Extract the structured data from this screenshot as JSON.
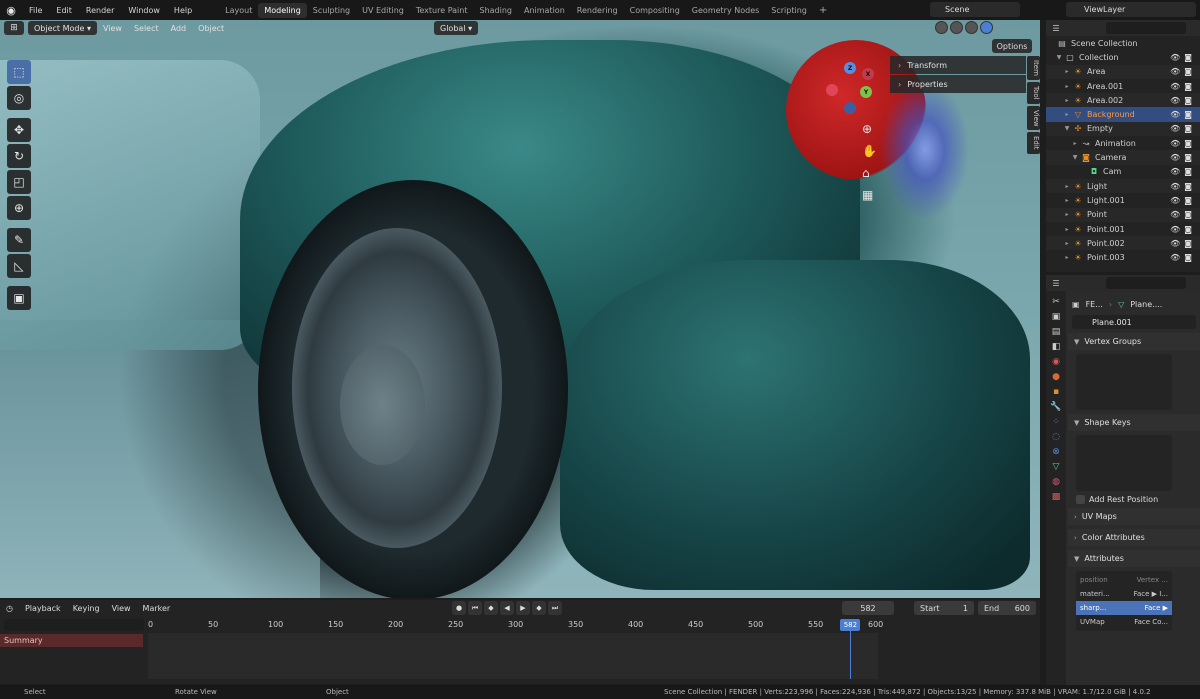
{
  "topbar": {
    "menus": [
      "File",
      "Edit",
      "Render",
      "Window",
      "Help"
    ],
    "workspaces": [
      "Layout",
      "Modeling",
      "Sculpting",
      "UV Editing",
      "Texture Paint",
      "Shading",
      "Animation",
      "Rendering",
      "Compositing",
      "Geometry Nodes",
      "Scripting"
    ],
    "active_workspace": "Modeling",
    "scene": "Scene",
    "view_layer": "ViewLayer"
  },
  "viewport": {
    "mode": "Object Mode",
    "menus": [
      "View",
      "Select",
      "Add",
      "Object"
    ],
    "orientation": "Global",
    "options_label": "Options",
    "npanel": [
      "Transform",
      "Properties"
    ],
    "side_tabs": [
      "Item",
      "Tool",
      "View",
      "Edit"
    ],
    "gizmo_axes": {
      "x": "X",
      "y": "Y",
      "z": "Z"
    }
  },
  "outliner": {
    "root": "Scene Collection",
    "items": [
      {
        "name": "Collection",
        "icon": "collection-icon"
      },
      {
        "name": "Area",
        "icon": "light-icon"
      },
      {
        "name": "Area.001",
        "icon": "light-icon"
      },
      {
        "name": "Area.002",
        "icon": "light-icon"
      },
      {
        "name": "Background",
        "icon": "mesh-icon",
        "selected": true
      },
      {
        "name": "Empty",
        "icon": "empty-icon"
      },
      {
        "name": "Animation",
        "icon": "action-icon"
      },
      {
        "name": "Camera",
        "icon": "camera-icon"
      },
      {
        "name": "Cam",
        "icon": "camera-data-icon"
      },
      {
        "name": "Light",
        "icon": "light-icon"
      },
      {
        "name": "Light.001",
        "icon": "light-icon"
      },
      {
        "name": "Point",
        "icon": "light-icon"
      },
      {
        "name": "Point.001",
        "icon": "light-icon"
      },
      {
        "name": "Point.002",
        "icon": "light-icon"
      },
      {
        "name": "Point.003",
        "icon": "light-icon"
      }
    ]
  },
  "properties": {
    "crumb_object": "FE...",
    "crumb_data": "Plane....",
    "data_name": "Plane.001",
    "panels": {
      "vertex_groups": "Vertex Groups",
      "shape_keys": "Shape Keys",
      "add_rest_position": "Add Rest Position",
      "uv_maps": "UV Maps",
      "color_attributes": "Color Attributes",
      "attributes": "Attributes"
    },
    "attributes": [
      {
        "name": "position",
        "domain": "Vertex ...",
        "header": true
      },
      {
        "name": "materi...",
        "domain": "Face ▶ I..."
      },
      {
        "name": "sharp...",
        "domain": "Face ▶",
        "selected": true
      },
      {
        "name": "UVMap",
        "domain": "Face Co..."
      }
    ]
  },
  "timeline": {
    "menus": [
      "Playback",
      "Keying",
      "View",
      "Marker"
    ],
    "current_frame": "582",
    "start_label": "Start",
    "start": "1",
    "end_label": "End",
    "end": "600",
    "summary": "Summary",
    "ruler": [
      "0",
      "50",
      "100",
      "150",
      "200",
      "250",
      "300",
      "350",
      "400",
      "450",
      "500",
      "550",
      "582",
      "600"
    ]
  },
  "statusbar": {
    "select": "Select",
    "rotate": "Rotate View",
    "object": "Object",
    "info": "Scene Collection | FENDER | Verts:223,996 | Faces:224,936 | Tris:449,872 | Objects:13/25 | Memory: 337.8 MiB | VRAM: 1.7/12.0 GiB | 4.0.2"
  }
}
